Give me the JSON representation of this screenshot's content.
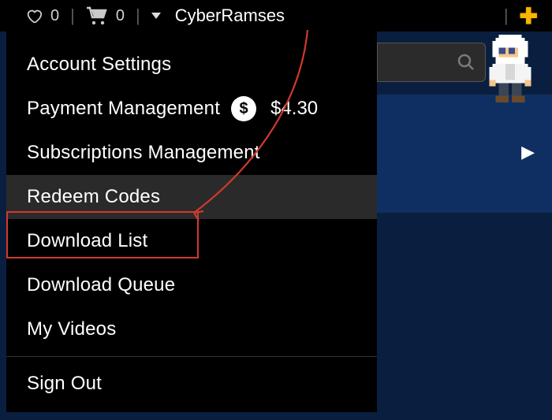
{
  "topbar": {
    "wishlist_count": "0",
    "cart_count": "0",
    "username": "CyberRamses"
  },
  "menu": {
    "account_settings": "Account Settings",
    "payment_management": "Payment Management",
    "balance": "$4.30",
    "subscriptions": "Subscriptions Management",
    "redeem": "Redeem Codes",
    "download_list": "Download List",
    "download_queue": "Download Queue",
    "my_videos": "My Videos",
    "sign_out": "Sign Out"
  },
  "colors": {
    "annotation_red": "#d03a2c",
    "bg_navy": "#0a1f3f"
  }
}
